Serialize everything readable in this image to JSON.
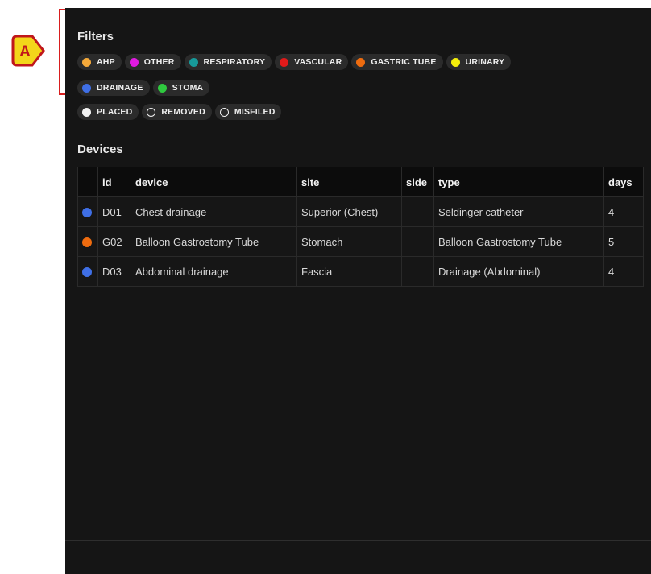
{
  "callout": {
    "label": "A"
  },
  "filters": {
    "title": "Filters",
    "categories": [
      {
        "label": "AHP",
        "color": "#f4a93a"
      },
      {
        "label": "OTHER",
        "color": "#e01ae0"
      },
      {
        "label": "RESPIRATORY",
        "color": "#179a9a"
      },
      {
        "label": "VASCULAR",
        "color": "#e11a1a"
      },
      {
        "label": "GASTRIC TUBE",
        "color": "#ef6c0f"
      },
      {
        "label": "URINARY",
        "color": "#f4ee0b"
      },
      {
        "label": "DRAINAGE",
        "color": "#3f6fe6"
      },
      {
        "label": "STOMA",
        "color": "#2fc93f"
      }
    ],
    "statuses": [
      {
        "label": "PLACED",
        "style": "filled",
        "color": "#f2f2f2"
      },
      {
        "label": "REMOVED",
        "style": "ring",
        "color": "#f2f2f2"
      },
      {
        "label": "MISFILED",
        "style": "ring",
        "color": "#f2f2f2"
      }
    ]
  },
  "devices": {
    "title": "Devices",
    "columns": [
      "",
      "id",
      "device",
      "site",
      "side",
      "type",
      "days"
    ],
    "rows": [
      {
        "color": "#3f6fe6",
        "id": "D01",
        "device": "Chest drainage",
        "site": "Superior (Chest)",
        "side": "",
        "type": "Seldinger catheter",
        "days": "4"
      },
      {
        "color": "#ef6c0f",
        "id": "G02",
        "device": "Balloon Gastrostomy Tube",
        "site": "Stomach",
        "side": "",
        "type": "Balloon Gastrostomy Tube",
        "days": "5"
      },
      {
        "color": "#3f6fe6",
        "id": "D03",
        "device": "Abdominal drainage",
        "site": "Fascia",
        "side": "",
        "type": "Drainage (Abdominal)",
        "days": "4"
      }
    ]
  }
}
